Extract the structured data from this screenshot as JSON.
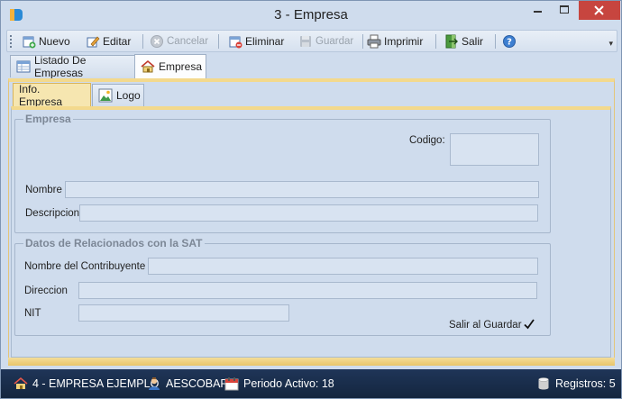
{
  "window": {
    "title": "3 - Empresa"
  },
  "toolbar": {
    "nuevo": "Nuevo",
    "editar": "Editar",
    "cancelar": "Cancelar",
    "eliminar": "Eliminar",
    "guardar": "Guardar",
    "imprimir": "Imprimir",
    "salir": "Salir"
  },
  "tabs": {
    "outer": [
      "Listado De Empresas",
      "Empresa"
    ],
    "inner": [
      "Info. Empresa",
      "Logo"
    ]
  },
  "empresa_group": {
    "legend": "Empresa",
    "codigo_label": "Codigo:",
    "codigo_value": "",
    "nombre_label": "Nombre",
    "nombre_value": "",
    "descripcion_label": "Descripcion",
    "descripcion_value": ""
  },
  "sat_group": {
    "legend": "Datos de Relacionados con la SAT",
    "contribuyente_label": "Nombre del Contribuyente",
    "contribuyente_value": "",
    "direccion_label": "Direccion",
    "direccion_value": "",
    "nit_label": "NIT",
    "nit_value": "",
    "salir_guardar_label": "Salir al Guardar",
    "salir_guardar_checked": true
  },
  "statusbar": {
    "empresa": "4 - EMPRESA EJEMPLO",
    "usuario": "AESCOBAR",
    "periodo": "Periodo Activo: 18",
    "registros": "Registros: 5"
  },
  "colors": {
    "accent_tab": "#f3d98d",
    "statusbar": "#1a2e4d",
    "close_button": "#c7453f"
  }
}
